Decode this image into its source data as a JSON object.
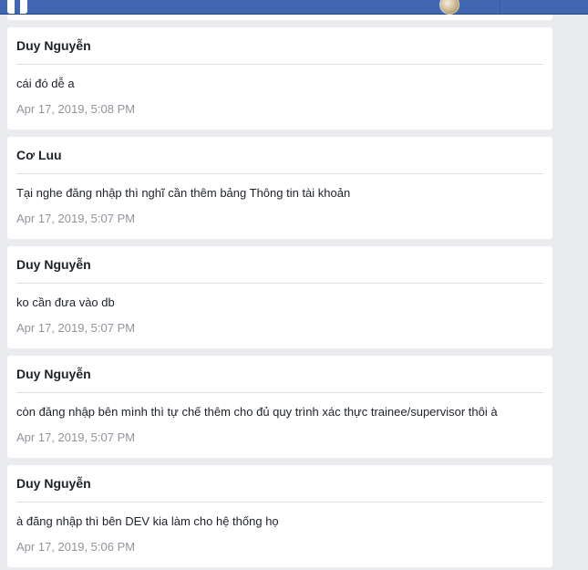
{
  "header": {
    "logo_icon": "facebook-logo-icon",
    "avatar_icon": "user-avatar-icon"
  },
  "colors": {
    "topbar": "#4267b2",
    "background": "#e9ebee",
    "card": "#ffffff",
    "name_text": "#1d2129",
    "timestamp_text": "#90949c"
  },
  "messages": [
    {
      "author": "Duy Nguyễn",
      "text": "cái đó dễ a",
      "time": "Apr 17, 2019, 5:08 PM"
    },
    {
      "author": "Cơ Luu",
      "text": "Tại nghe đăng nhập thì nghĩ cần thêm bảng Thông tin tài khoản",
      "time": "Apr 17, 2019, 5:07 PM"
    },
    {
      "author": "Duy Nguyễn",
      "text": "ko cần đưa vào db",
      "time": "Apr 17, 2019, 5:07 PM"
    },
    {
      "author": "Duy Nguyễn",
      "text": "còn đăng nhập bên mình thì tự chế thêm cho đủ quy trình xác thực trainee/supervisor thôi à",
      "time": "Apr 17, 2019, 5:07 PM"
    },
    {
      "author": "Duy Nguyễn",
      "text": "à đăng nhập thì bên DEV kia làm cho hệ thống họ",
      "time": "Apr 17, 2019, 5:06 PM"
    }
  ]
}
